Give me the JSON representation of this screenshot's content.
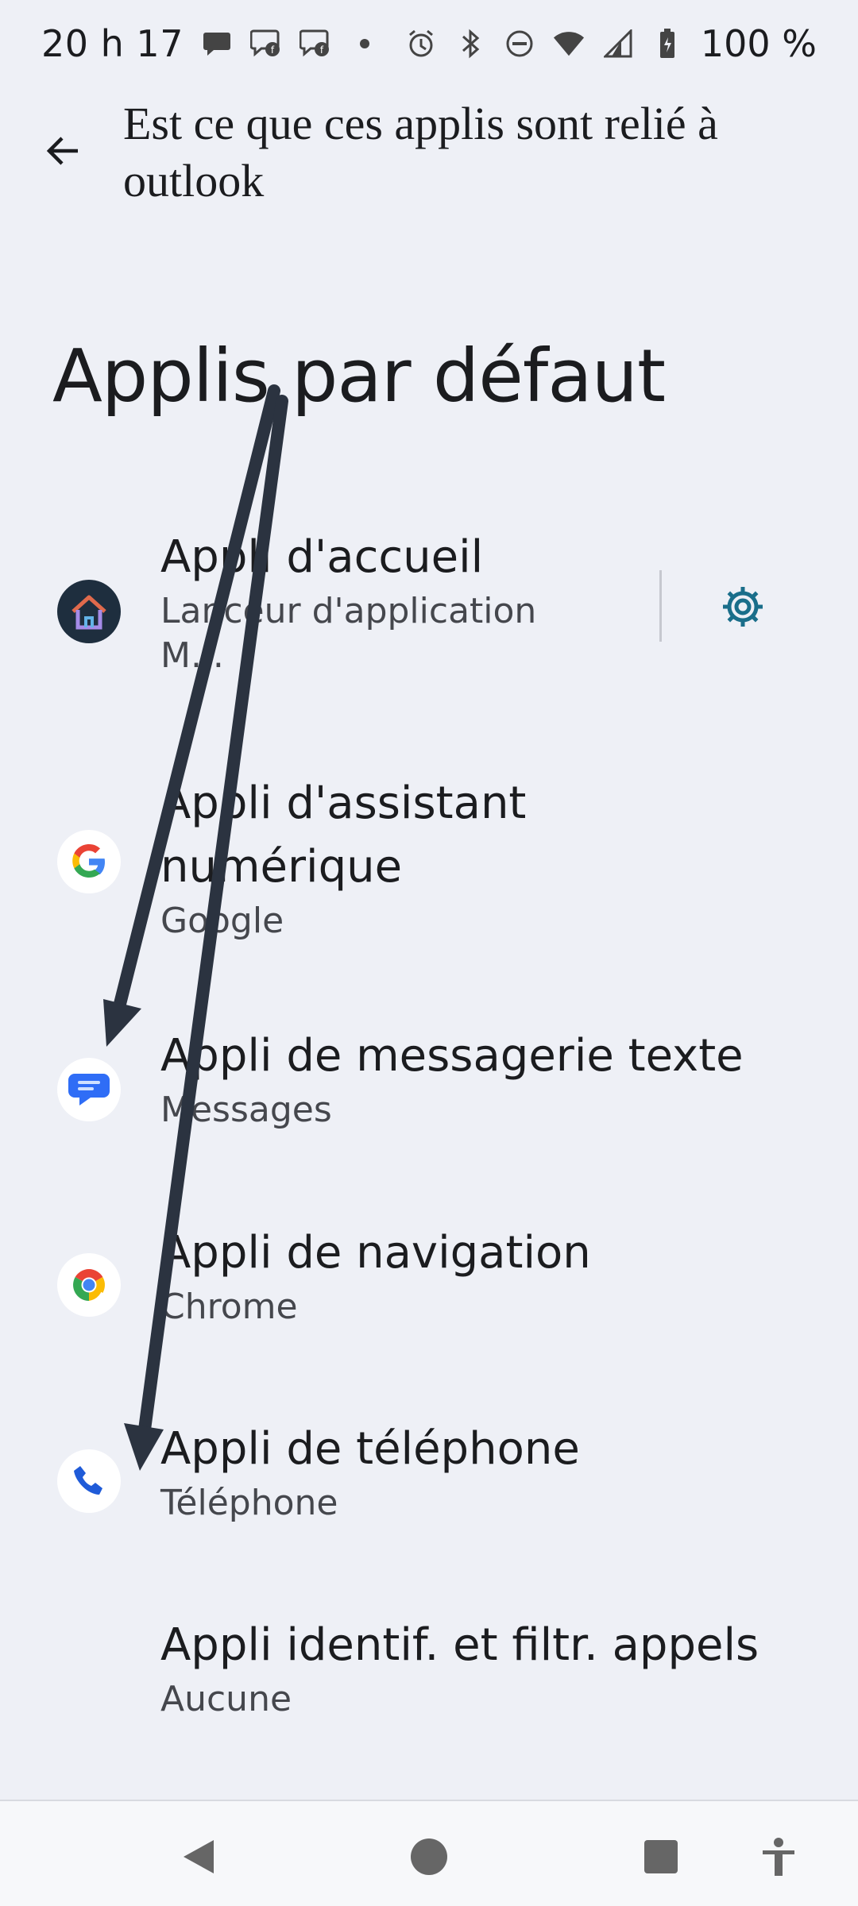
{
  "status_bar": {
    "time": "20 h 17",
    "battery": "100 %"
  },
  "header": {
    "question": "Est ce que ces applis sont relié à outlook"
  },
  "page": {
    "title": "Applis par défaut"
  },
  "rows": [
    {
      "title": "Appli d'accueil",
      "subtitle": "Lanceur d'application M...",
      "icon": "launcher-house-icon"
    },
    {
      "title": "Appli d'assistant numérique",
      "subtitle": "Google",
      "icon": "google-icon"
    },
    {
      "title": "Appli de messagerie texte",
      "subtitle": "Messages",
      "icon": "messages-icon"
    },
    {
      "title": "Appli de navigation",
      "subtitle": "Chrome",
      "icon": "chrome-icon"
    },
    {
      "title": "Appli de téléphone",
      "subtitle": "Téléphone",
      "icon": "phone-icon"
    },
    {
      "title": "Appli identif. et filtr. appels",
      "subtitle": "Aucune",
      "icon": ""
    }
  ],
  "colors": {
    "background": "#eef0f6",
    "accent": "#1a6e8a",
    "arrow": "#2b3340"
  }
}
